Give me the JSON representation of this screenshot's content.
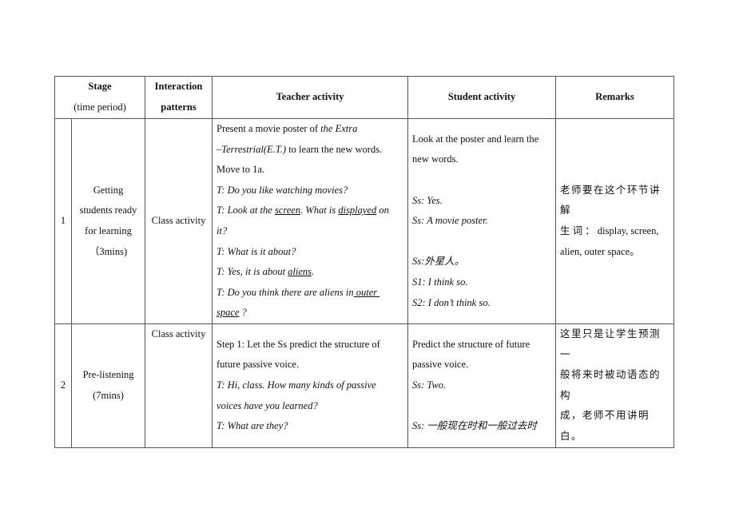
{
  "table": {
    "headers": {
      "stage": "Stage",
      "stage_sub": "(time period)",
      "interaction_1": "Interaction",
      "interaction_2": "patterns",
      "teacher": "Teacher activity",
      "student": "Student activity",
      "remarks": "Remarks"
    },
    "rows": [
      {
        "number": "1",
        "stage_lines": [
          "Getting",
          "students ready",
          "for learning",
          "（3mins)"
        ],
        "pattern": "Class activity",
        "teacher": {
          "l1_plain": "Present a movie poster of ",
          "l1_italic": "the Extra",
          "l2_italic": "–Terrestrial(E.T.)",
          "l2_plain": " to learn the new words.",
          "l3": "Move to 1a.",
          "l4": "T: Do you like watching movies?",
          "l5_a": "T: Look at the ",
          "l5_u1": "screen",
          "l5_b": ". What is ",
          "l5_u2": "displayed",
          "l5_c": " on",
          "l6": "it?",
          "l7": "T: What is it about?",
          "l8_a": "T: Yes, it is about ",
          "l8_u": "aliens",
          "l8_b": ".",
          "l9_a": "T: Do you think there are aliens in",
          "l9_u": " outer ",
          "l10_u": "space",
          "l10_b": " ?"
        },
        "student": {
          "l1": "Look at the poster and learn the",
          "l2": "new words.",
          "l4": "Ss: Yes.",
          "l5": "Ss: A movie poster.",
          "l7": "Ss:外星人。",
          "l8": "S1: I think so.",
          "l9": "S2: I don’t think so."
        },
        "remarks": {
          "l1": "老师要在这个环节讲解",
          "l2": "生 词 ： display, screen,",
          "l3": "alien, outer space。"
        }
      },
      {
        "number": "2",
        "stage_lines": [
          "Pre-listening",
          "(7mins)"
        ],
        "pattern": "Class activity",
        "teacher": {
          "l1": "Step 1: Let the Ss predict the structure of",
          "l2": "future passive voice.",
          "l3": "T: Hi, class. How many kinds of passive",
          "l4": "voices have you learned?",
          "l5": "T: What are they?"
        },
        "student": {
          "l1": "Predict the structure of future",
          "l2": "passive voice.",
          "l3": "Ss: Two.",
          "l5": "Ss: 一般现在时和一般过去时"
        },
        "remarks": {
          "l1": "这里只是让学生预测一",
          "l2": "般将来时被动语态的构",
          "l3": "成，老师不用讲明白。"
        }
      }
    ]
  }
}
